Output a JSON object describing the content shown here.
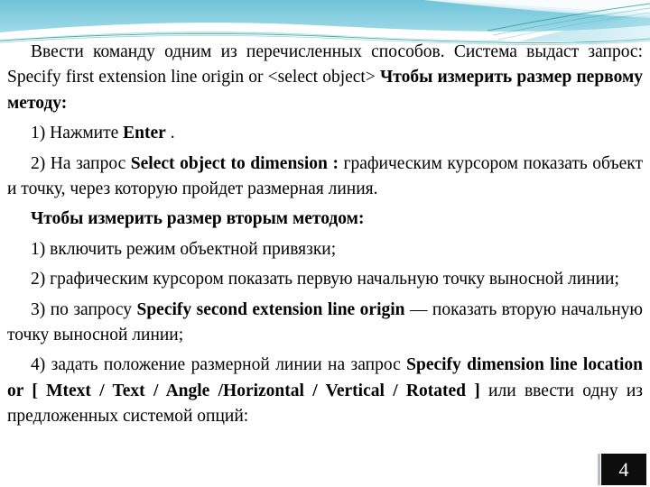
{
  "slide": {
    "page_number": "4",
    "banner": {
      "icon": "wave-decoration",
      "colors": {
        "cyan_light": "#a6dcea",
        "cyan_mid": "#7ccbdd",
        "cyan_deep": "#4fb8cf",
        "teal_line": "#1c9b9b",
        "white": "#ffffff"
      }
    },
    "body": {
      "p1": {
        "t1": "Ввести команду одним из перечисленных способов. Система выдаст запрос: Specify first extension line origin or <select object> ",
        "b1": "Чтобы измерить размер первому методу:"
      },
      "p2": {
        "t1": "1) Нажмите ",
        "b1": "Enter",
        "t2": " ."
      },
      "p3": {
        "t1": "2) На запрос ",
        "b1": "Select object to dimension :",
        "t2": " графическим курсором показать объект и точку, через которую пройдет размерная линия."
      },
      "p4": {
        "b1": "Чтобы измерить размер вторым методом:"
      },
      "p5": {
        "t1": "1) включить режим объектной привязки;"
      },
      "p6": {
        "t1": "2) графическим курсором показать первую начальную точку выносной линии;"
      },
      "p7": {
        "t1": "3) по запросу ",
        "b1": "Specify second extension line origin",
        "t2": " — показать вторую начальную точку выносной линии;"
      },
      "p8": {
        "t1": "4) задать положение размерной линии на запрос ",
        "b1": "Specify dimension line location or   [ Mtext   / Text   / Angle /Horizontal / Vertical / Rotated ]",
        "t2": " или ввести одну из предложенных системой опций:"
      }
    }
  }
}
